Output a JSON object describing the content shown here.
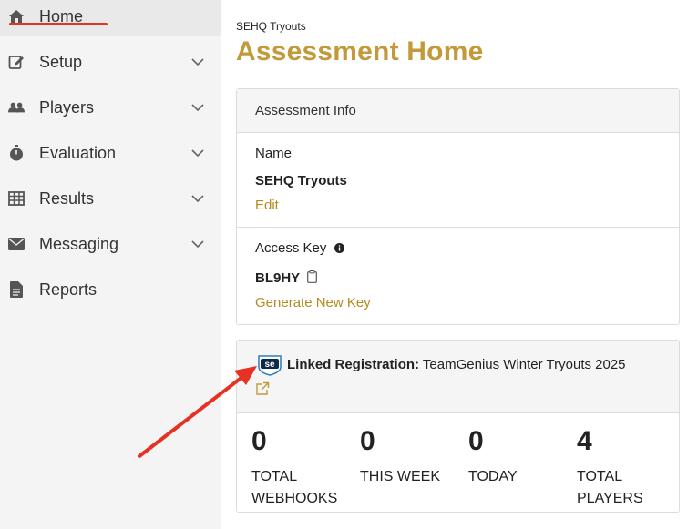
{
  "sidebar": {
    "items": [
      {
        "label": "Home",
        "icon": "home-icon",
        "active": true,
        "expandable": false
      },
      {
        "label": "Setup",
        "icon": "edit-icon",
        "active": false,
        "expandable": true
      },
      {
        "label": "Players",
        "icon": "players-icon",
        "active": false,
        "expandable": true
      },
      {
        "label": "Evaluation",
        "icon": "stopwatch-icon",
        "active": false,
        "expandable": true
      },
      {
        "label": "Results",
        "icon": "table-icon",
        "active": false,
        "expandable": true
      },
      {
        "label": "Messaging",
        "icon": "envelope-icon",
        "active": false,
        "expandable": true
      },
      {
        "label": "Reports",
        "icon": "document-icon",
        "active": false,
        "expandable": false
      }
    ]
  },
  "header": {
    "breadcrumb": "SEHQ Tryouts",
    "title": "Assessment Home"
  },
  "assessment_info": {
    "header": "Assessment Info",
    "name_label": "Name",
    "name_value": "SEHQ Tryouts",
    "edit_link": "Edit",
    "access_key_label": "Access Key",
    "access_key_value": "BL9HY",
    "generate_link": "Generate New Key"
  },
  "linked_registration": {
    "label": "Linked Registration:",
    "value": "TeamGenius Winter Tryouts 2025",
    "logo_text": "se",
    "stats": [
      {
        "value": "0",
        "label": "TOTAL WEBHOOKS"
      },
      {
        "value": "0",
        "label": "THIS WEEK"
      },
      {
        "value": "0",
        "label": "TODAY"
      },
      {
        "value": "4",
        "label": "TOTAL PLAYERS"
      }
    ]
  },
  "colors": {
    "accent_gold": "#c29a3a",
    "link_gold": "#b58a1f",
    "annotation_red": "#e53222",
    "sidebar_bg": "#f4f4f4"
  }
}
